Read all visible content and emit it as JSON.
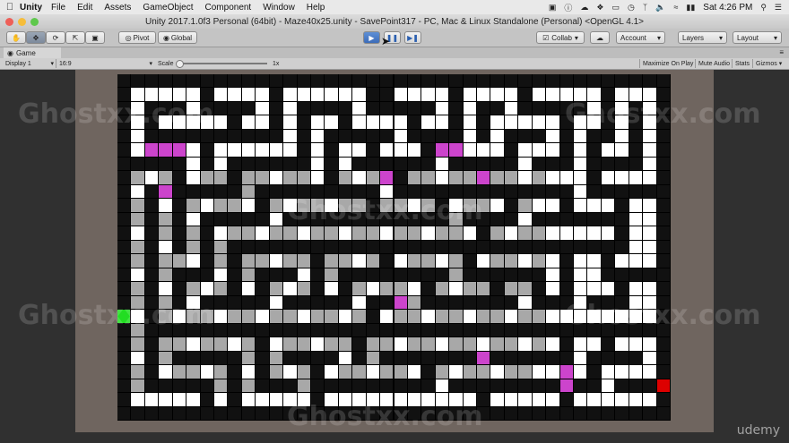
{
  "menubar": {
    "app_name": "Unity",
    "items": [
      "File",
      "Edit",
      "Assets",
      "GameObject",
      "Component",
      "Window",
      "Help"
    ],
    "clock": "Sat 4:26 PM"
  },
  "window": {
    "title": "Unity 2017.1.0f3 Personal (64bit) - Maze40x25.unity - SavePoint317 - PC, Mac & Linux Standalone (Personal) <OpenGL 4.1>"
  },
  "toolbar": {
    "pivot_label": "Pivot",
    "global_label": "Global",
    "collab_label": "Collab",
    "account_label": "Account",
    "layers_label": "Layers",
    "layout_label": "Layout"
  },
  "game_tab": {
    "label": "Game"
  },
  "game_bar": {
    "display": "Display 1",
    "aspect": "16:9",
    "scale_label": "Scale",
    "scale_value": "1x",
    "maximize": "Maximize On Play",
    "mute": "Mute Audio",
    "stats": "Stats",
    "gizmos": "Gizmos"
  },
  "watermark": "Ghostxx.com",
  "brand": "udemy",
  "colors": {
    "wall": "#111111",
    "open": "#ffffff",
    "path": "#a8a8a8",
    "visited": "#cc44cc",
    "start": "#22dd22",
    "end": "#dd0000"
  },
  "maze_rows": [
    "0000000000000000000000000000000000000000",
    "0111110111101111110011110111101111101110",
    "0100010000101000010000010100100000101010",
    "0101111101101011011110110101111101101010",
    "0100000000001010000010000101000101001010",
    "0111110111111010110111011111011101011010",
    "0000010100000010100000010000010001000010",
    "0111011101111110111101111111111111011110",
    "0101000001000000000100000000000001000000",
    "0101011111011111110111101111011101110110",
    "0101010000010000000000001000010000000110",
    "0101010111111111111111111101111111110110",
    "0101010100000000000000000000000000000110",
    "0101110101111101111011111011111101101110",
    "0101000101000101000000001000000101100000",
    "0101011101011101011111011110110101110110",
    "0101010000010000010001000000010001000110",
    "0101111111111111110111111111111111111110",
    "0100000000000000000000000000000000000000",
    "0101111111011111101111111111111101101110",
    "0101000001010000101000000000000001000010",
    "0101111101011101111111011111111111011110",
    "0100000101000100000000010000000000010000",
    "0111110101111101111111111101111101111110",
    "0000000000000000000000000000000000000000"
  ],
  "maze_highlights": {
    "start": [
      17,
      0
    ],
    "end": [
      22,
      39
    ],
    "visited": [
      [
        5,
        2
      ],
      [
        5,
        3
      ],
      [
        5,
        4
      ],
      [
        5,
        23
      ],
      [
        5,
        24
      ],
      [
        7,
        19
      ],
      [
        7,
        26
      ],
      [
        8,
        3
      ],
      [
        16,
        20
      ],
      [
        20,
        26
      ],
      [
        21,
        32
      ],
      [
        22,
        32
      ]
    ]
  }
}
